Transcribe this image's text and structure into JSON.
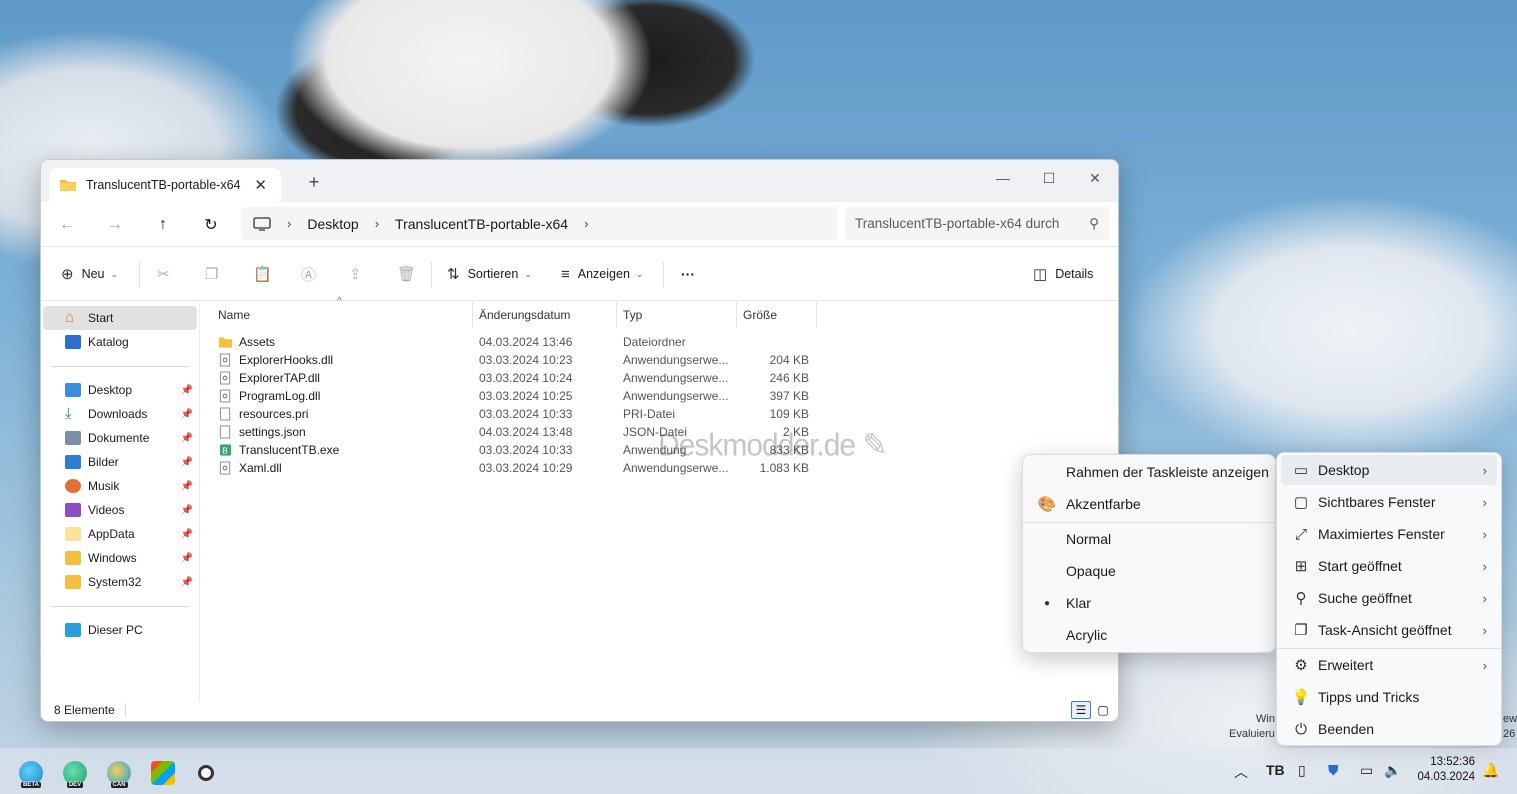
{
  "window": {
    "tab_title": "TranslucentTB-portable-x64",
    "breadcrumb": [
      "Desktop",
      "TranslucentTB-portable-x64"
    ],
    "search_placeholder": "TranslucentTB-portable-x64 durch"
  },
  "toolbar": {
    "new_label": "Neu",
    "sort_label": "Sortieren",
    "view_label": "Anzeigen",
    "more_label": "···",
    "details_label": "Details"
  },
  "sidebar": {
    "top": [
      {
        "label": "Start",
        "icon": "home-icon"
      },
      {
        "label": "Katalog",
        "icon": "gallery-icon"
      }
    ],
    "pinned": [
      {
        "label": "Desktop",
        "icon": "desktop-icon"
      },
      {
        "label": "Downloads",
        "icon": "download-icon"
      },
      {
        "label": "Dokumente",
        "icon": "documents-icon"
      },
      {
        "label": "Bilder",
        "icon": "pictures-icon"
      },
      {
        "label": "Musik",
        "icon": "music-icon"
      },
      {
        "label": "Videos",
        "icon": "videos-icon"
      },
      {
        "label": "AppData",
        "icon": "folder-icon"
      },
      {
        "label": "Windows",
        "icon": "folder-icon"
      },
      {
        "label": "System32",
        "icon": "folder-icon"
      }
    ],
    "this_pc": "Dieser PC"
  },
  "columns": {
    "name": "Name",
    "date": "Änderungsdatum",
    "type": "Typ",
    "size": "Größe"
  },
  "files": [
    {
      "name": "Assets",
      "date": "04.03.2024 13:46",
      "type": "Dateiordner",
      "size": "",
      "icon": "folder-icon"
    },
    {
      "name": "ExplorerHooks.dll",
      "date": "03.03.2024 10:23",
      "type": "Anwendungserwe...",
      "size": "204 KB",
      "icon": "dll-icon"
    },
    {
      "name": "ExplorerTAP.dll",
      "date": "03.03.2024 10:24",
      "type": "Anwendungserwe...",
      "size": "246 KB",
      "icon": "dll-icon"
    },
    {
      "name": "ProgramLog.dll",
      "date": "03.03.2024 10:25",
      "type": "Anwendungserwe...",
      "size": "397 KB",
      "icon": "dll-icon"
    },
    {
      "name": "resources.pri",
      "date": "03.03.2024 10:33",
      "type": "PRI-Datei",
      "size": "109 KB",
      "icon": "file-icon"
    },
    {
      "name": "settings.json",
      "date": "04.03.2024 13:48",
      "type": "JSON-Datei",
      "size": "2 KB",
      "icon": "file-icon"
    },
    {
      "name": "TranslucentTB.exe",
      "date": "03.03.2024 10:33",
      "type": "Anwendung",
      "size": "833 KB",
      "icon": "app-icon"
    },
    {
      "name": "Xaml.dll",
      "date": "03.03.2024 10:29",
      "type": "Anwendungserwe...",
      "size": "1.083 KB",
      "icon": "dll-icon"
    }
  ],
  "status": {
    "count": "8 Elemente"
  },
  "watermark": "Deskmodder.de",
  "submenu": {
    "items": [
      {
        "label": "Rahmen der Taskleiste anzeigen",
        "icon": ""
      },
      {
        "label": "Akzentfarbe",
        "icon": "palette-icon"
      }
    ],
    "options": [
      {
        "label": "Normal",
        "selected": false
      },
      {
        "label": "Opaque",
        "selected": false
      },
      {
        "label": "Klar",
        "selected": true
      },
      {
        "label": "Acrylic",
        "selected": false
      }
    ]
  },
  "mainmenu": {
    "items": [
      {
        "label": "Desktop",
        "icon": "desktop-state-icon"
      },
      {
        "label": "Sichtbares Fenster",
        "icon": "window-icon"
      },
      {
        "label": "Maximiertes Fenster",
        "icon": "maximize-icon"
      },
      {
        "label": "Start geöffnet",
        "icon": "start-icon"
      },
      {
        "label": "Suche geöffnet",
        "icon": "search-icon"
      },
      {
        "label": "Task-Ansicht geöffnet",
        "icon": "taskview-icon"
      }
    ],
    "extra": [
      {
        "label": "Erweitert",
        "icon": "gear-icon",
        "arrow": true
      },
      {
        "label": "Tipps und Tricks",
        "icon": "lightbulb-icon",
        "arrow": false
      },
      {
        "label": "Beenden",
        "icon": "power-icon",
        "arrow": false
      }
    ]
  },
  "taskbar": {
    "apps": [
      {
        "name": "edge-beta",
        "tag": "BETA",
        "color": "#1e88d6"
      },
      {
        "name": "edge-dev",
        "tag": "DEV",
        "color": "#1e9e6a"
      },
      {
        "name": "edge-canary",
        "tag": "CAN",
        "color": "#1a9fd8"
      }
    ],
    "time": "13:52:36",
    "date": "04.03.2024",
    "eval_line1": "Win",
    "eval_line2": "Evaluieru",
    "eval_right1": "ew",
    "eval_right2": "26"
  }
}
